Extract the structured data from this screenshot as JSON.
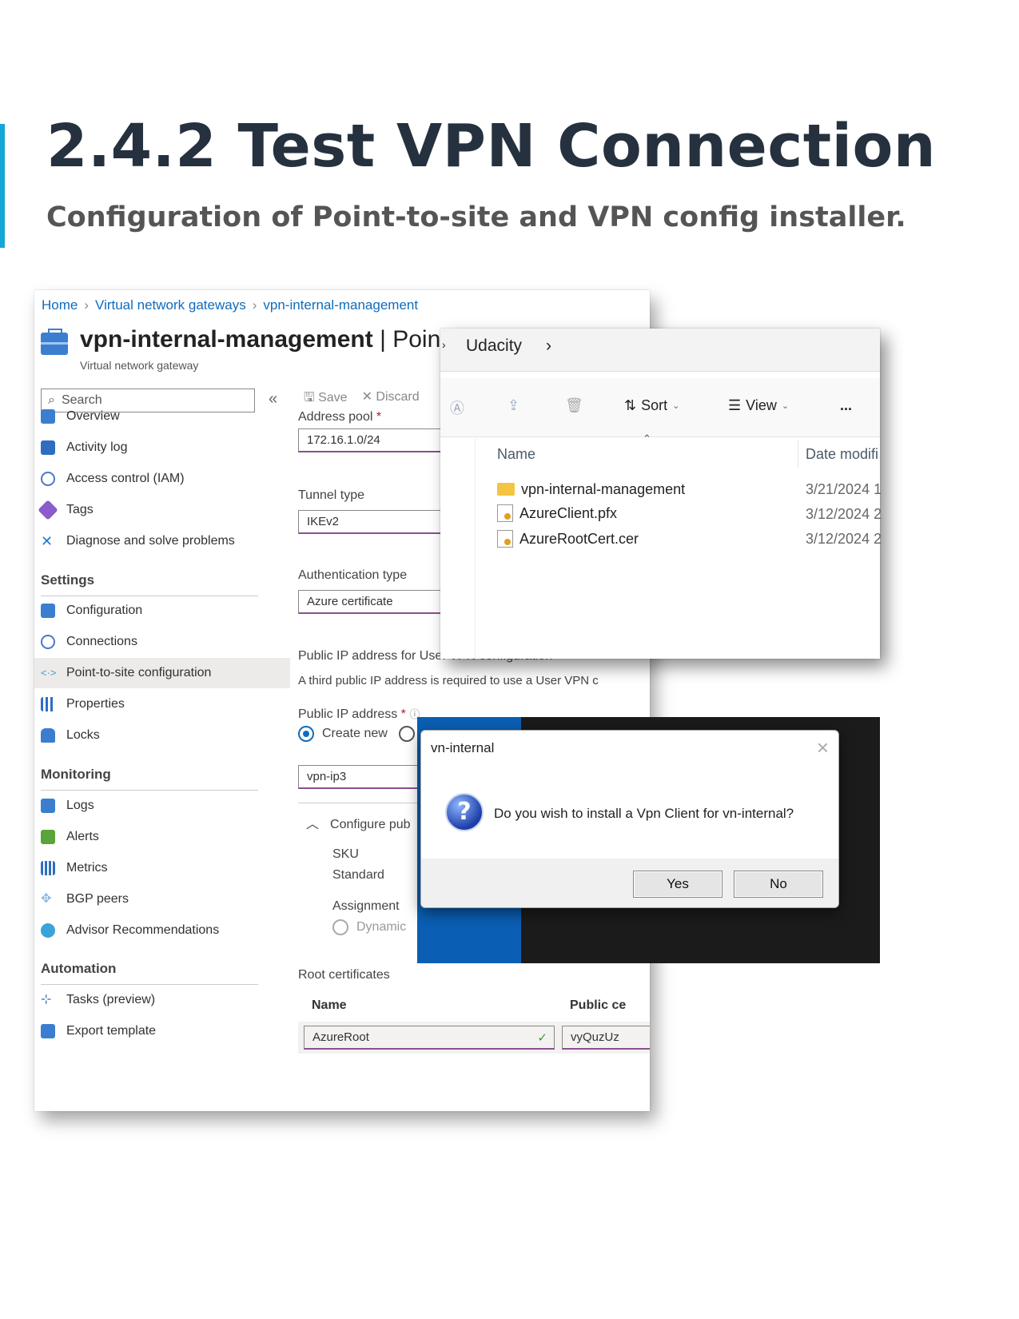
{
  "heading": {
    "title": "2.4.2 Test VPN Connection",
    "subtitle": "Configuration of Point-to-site and VPN config installer."
  },
  "azure": {
    "breadcrumb": [
      "Home",
      "Virtual network gateways",
      "vpn-internal-management"
    ],
    "resource_name": "vpn-internal-management",
    "resource_section": "| Point-to-site configurati",
    "resource_type": "Virtual network gateway",
    "search_placeholder": "Search",
    "collapse_glyph": "«",
    "nav": {
      "top": [
        "Overview",
        "Activity log",
        "Access control (IAM)",
        "Tags",
        "Diagnose and solve problems"
      ],
      "settings_head": "Settings",
      "settings": [
        "Configuration",
        "Connections",
        "Point-to-site configuration",
        "Properties",
        "Locks"
      ],
      "monitoring_head": "Monitoring",
      "monitoring": [
        "Logs",
        "Alerts",
        "Metrics",
        "BGP peers",
        "Advisor Recommendations"
      ],
      "automation_head": "Automation",
      "automation": [
        "Tasks (preview)",
        "Export template"
      ]
    },
    "toolbar": {
      "save": "Save",
      "discard": "Discard"
    },
    "form": {
      "address_pool_label": "Address pool",
      "address_pool_value": "172.16.1.0/24",
      "tunnel_type_label": "Tunnel type",
      "tunnel_type_value": "IKEv2",
      "auth_type_label": "Authentication type",
      "auth_type_value": "Azure certificate",
      "public_ip_section": "Public IP address for Use. VPN configuration",
      "public_ip_note": "A third public IP address is required to use a User VPN c",
      "public_ip_label": "Public IP address",
      "create_new": "Create new",
      "public_ip_value": "vpn-ip3",
      "configure_pub": "Configure pub",
      "sku_label": "SKU",
      "sku_value": "Standard",
      "assignment_label": "Assignment",
      "assignment_value": "Dynamic",
      "root_certs_label": "Root certificates",
      "col_name": "Name",
      "col_public": "Public ce",
      "cert_name": "AzureRoot",
      "cert_data": "vyQuzUz"
    }
  },
  "explorer": {
    "path": "Udacity",
    "toolbar": {
      "sort": "Sort",
      "view": "View",
      "more": "..."
    },
    "col_name": "Name",
    "col_date": "Date modifi",
    "files": [
      {
        "name": "vpn-internal-management",
        "date": "3/21/2024 1",
        "kind": "folder"
      },
      {
        "name": "AzureClient.pfx",
        "date": "3/12/2024 2",
        "kind": "pfx"
      },
      {
        "name": "AzureRootCert.cer",
        "date": "3/12/2024 2",
        "kind": "cer"
      }
    ]
  },
  "dialog": {
    "title": "vn-internal",
    "icon": "question-icon",
    "message": "Do you wish to install a Vpn Client for vn-internal?",
    "yes": "Yes",
    "no": "No"
  },
  "colors": {
    "accent": "#13a7d6",
    "azure_link": "#0f6cbd",
    "title": "#26313f"
  }
}
